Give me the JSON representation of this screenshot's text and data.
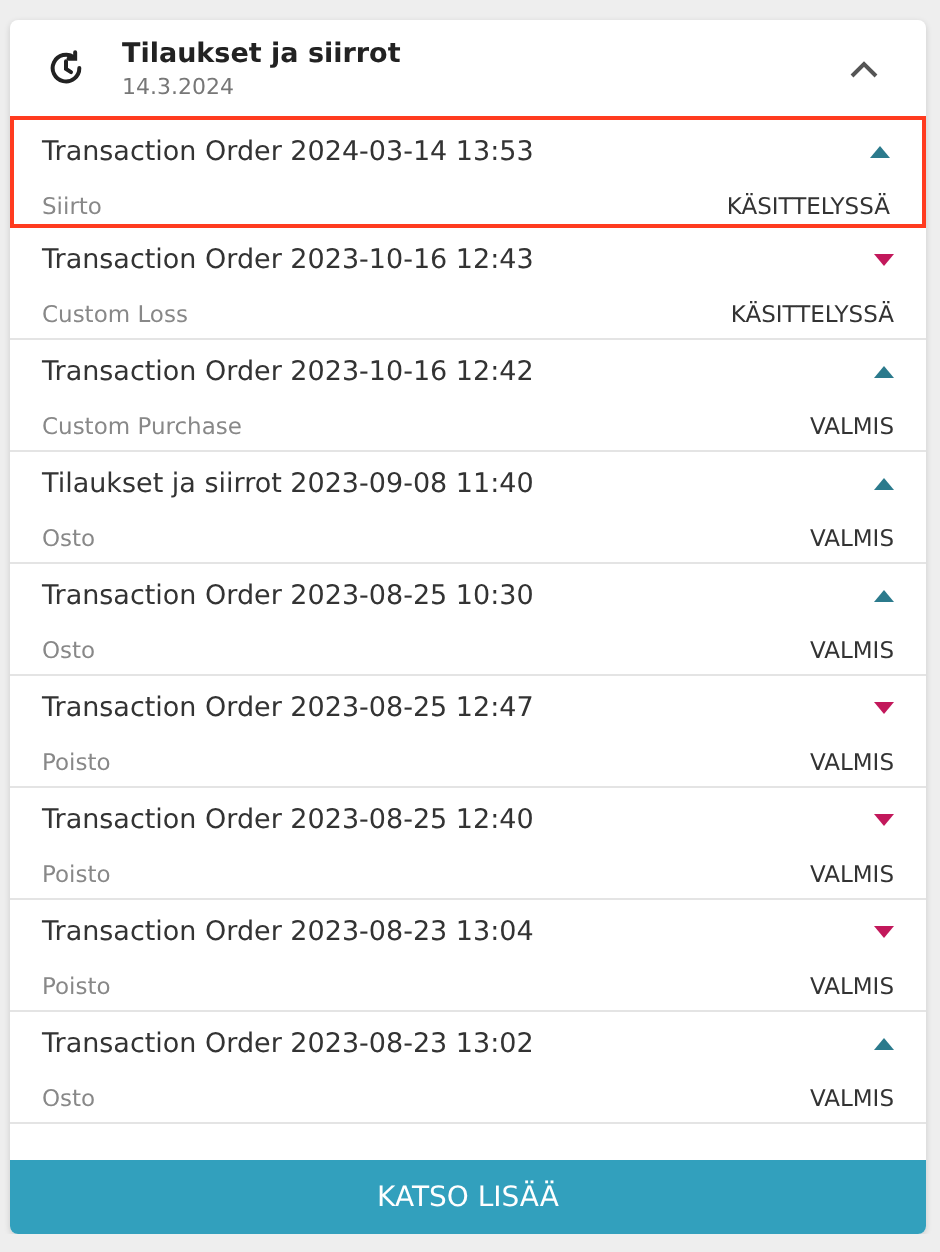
{
  "header": {
    "title": "Tilaukset ja siirrot",
    "date": "14.3.2024",
    "expanded": true
  },
  "orders": [
    {
      "title": "Transaction Order 2024-03-14 13:53",
      "type": "Siirto",
      "status": "KÄSITTELYSSÄ",
      "kind": "up",
      "selected": true
    },
    {
      "title": "Transaction Order 2023-10-16 12:43",
      "type": "Custom Loss",
      "status": "KÄSITTELYSSÄ",
      "kind": "down",
      "selected": false
    },
    {
      "title": "Transaction Order 2023-10-16 12:42",
      "type": "Custom Purchase",
      "status": "VALMIS",
      "kind": "up",
      "selected": false
    },
    {
      "title": "Tilaukset ja siirrot 2023-09-08 11:40",
      "type": "Osto",
      "status": "VALMIS",
      "kind": "up",
      "selected": false
    },
    {
      "title": "Transaction Order 2023-08-25 10:30",
      "type": "Osto",
      "status": "VALMIS",
      "kind": "up",
      "selected": false
    },
    {
      "title": "Transaction Order 2023-08-25 12:47",
      "type": "Poisto",
      "status": "VALMIS",
      "kind": "down",
      "selected": false
    },
    {
      "title": "Transaction Order 2023-08-25 12:40",
      "type": "Poisto",
      "status": "VALMIS",
      "kind": "down",
      "selected": false
    },
    {
      "title": "Transaction Order 2023-08-23 13:04",
      "type": "Poisto",
      "status": "VALMIS",
      "kind": "down",
      "selected": false
    },
    {
      "title": "Transaction Order 2023-08-23 13:02",
      "type": "Osto",
      "status": "VALMIS",
      "kind": "up",
      "selected": false
    }
  ],
  "more_button": "KATSO LISÄÄ"
}
